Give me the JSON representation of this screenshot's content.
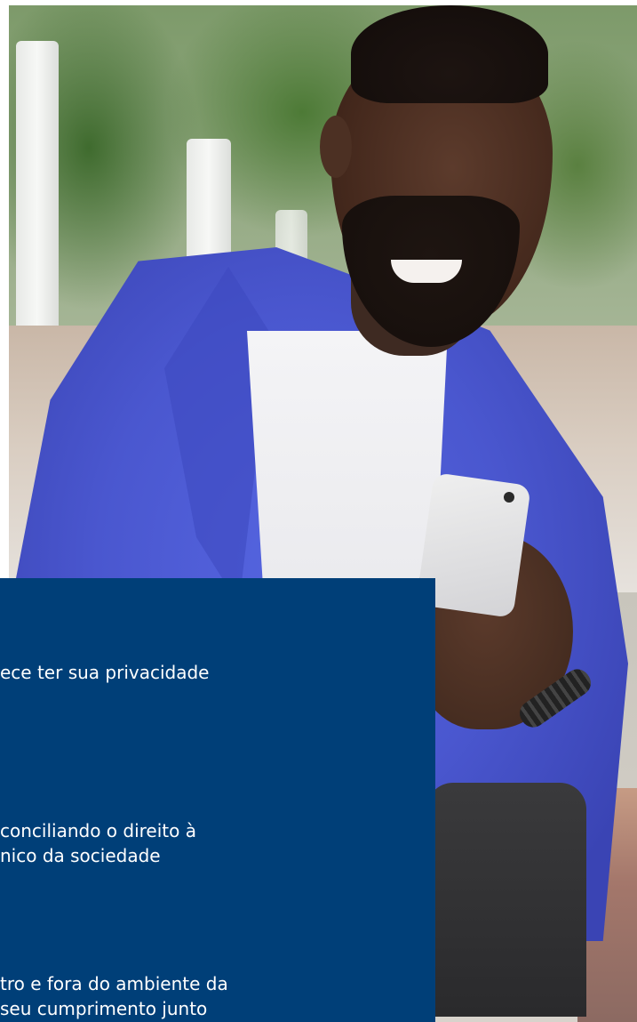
{
  "hero": {
    "photo_description_icon": "person-with-phone-photo"
  },
  "panel": {
    "background_color": "#003f78",
    "text_color": "#ffffff",
    "paragraphs": [
      {
        "lines": [
          "ece ter sua privacidade"
        ]
      },
      {
        "lines": [
          " conciliando o direito à",
          "nico da sociedade"
        ]
      },
      {
        "lines": [
          "tro e fora do ambiente da",
          " seu cumprimento junto"
        ]
      }
    ]
  }
}
